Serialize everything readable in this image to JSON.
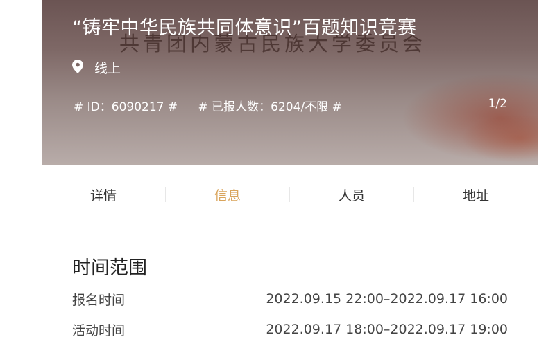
{
  "hero": {
    "title": "“铸牢中华民族共同体意识”百题知识竞赛",
    "background_text": "共青团内蒙古民族大学委员会",
    "location": "线上",
    "id_text": "# ID：6090217 #",
    "signup_text": "# 已报人数：6204/不限 #",
    "pager": "1/2"
  },
  "tabs": [
    {
      "label": "详情"
    },
    {
      "label": "信息",
      "active": true
    },
    {
      "label": "人员"
    },
    {
      "label": "地址"
    }
  ],
  "section": {
    "title": "时间范围",
    "rows": [
      {
        "label": "报名时间",
        "value": "2022.09.15 22:00–2022.09.17 16:00"
      },
      {
        "label": "活动时间",
        "value": "2022.09.17 18:00–2022.09.17 19:00"
      }
    ]
  },
  "colors": {
    "active_tab": "#d9a45b",
    "hero_overlay": "#7e6866"
  },
  "icons": {
    "location": "map-pin-icon"
  }
}
